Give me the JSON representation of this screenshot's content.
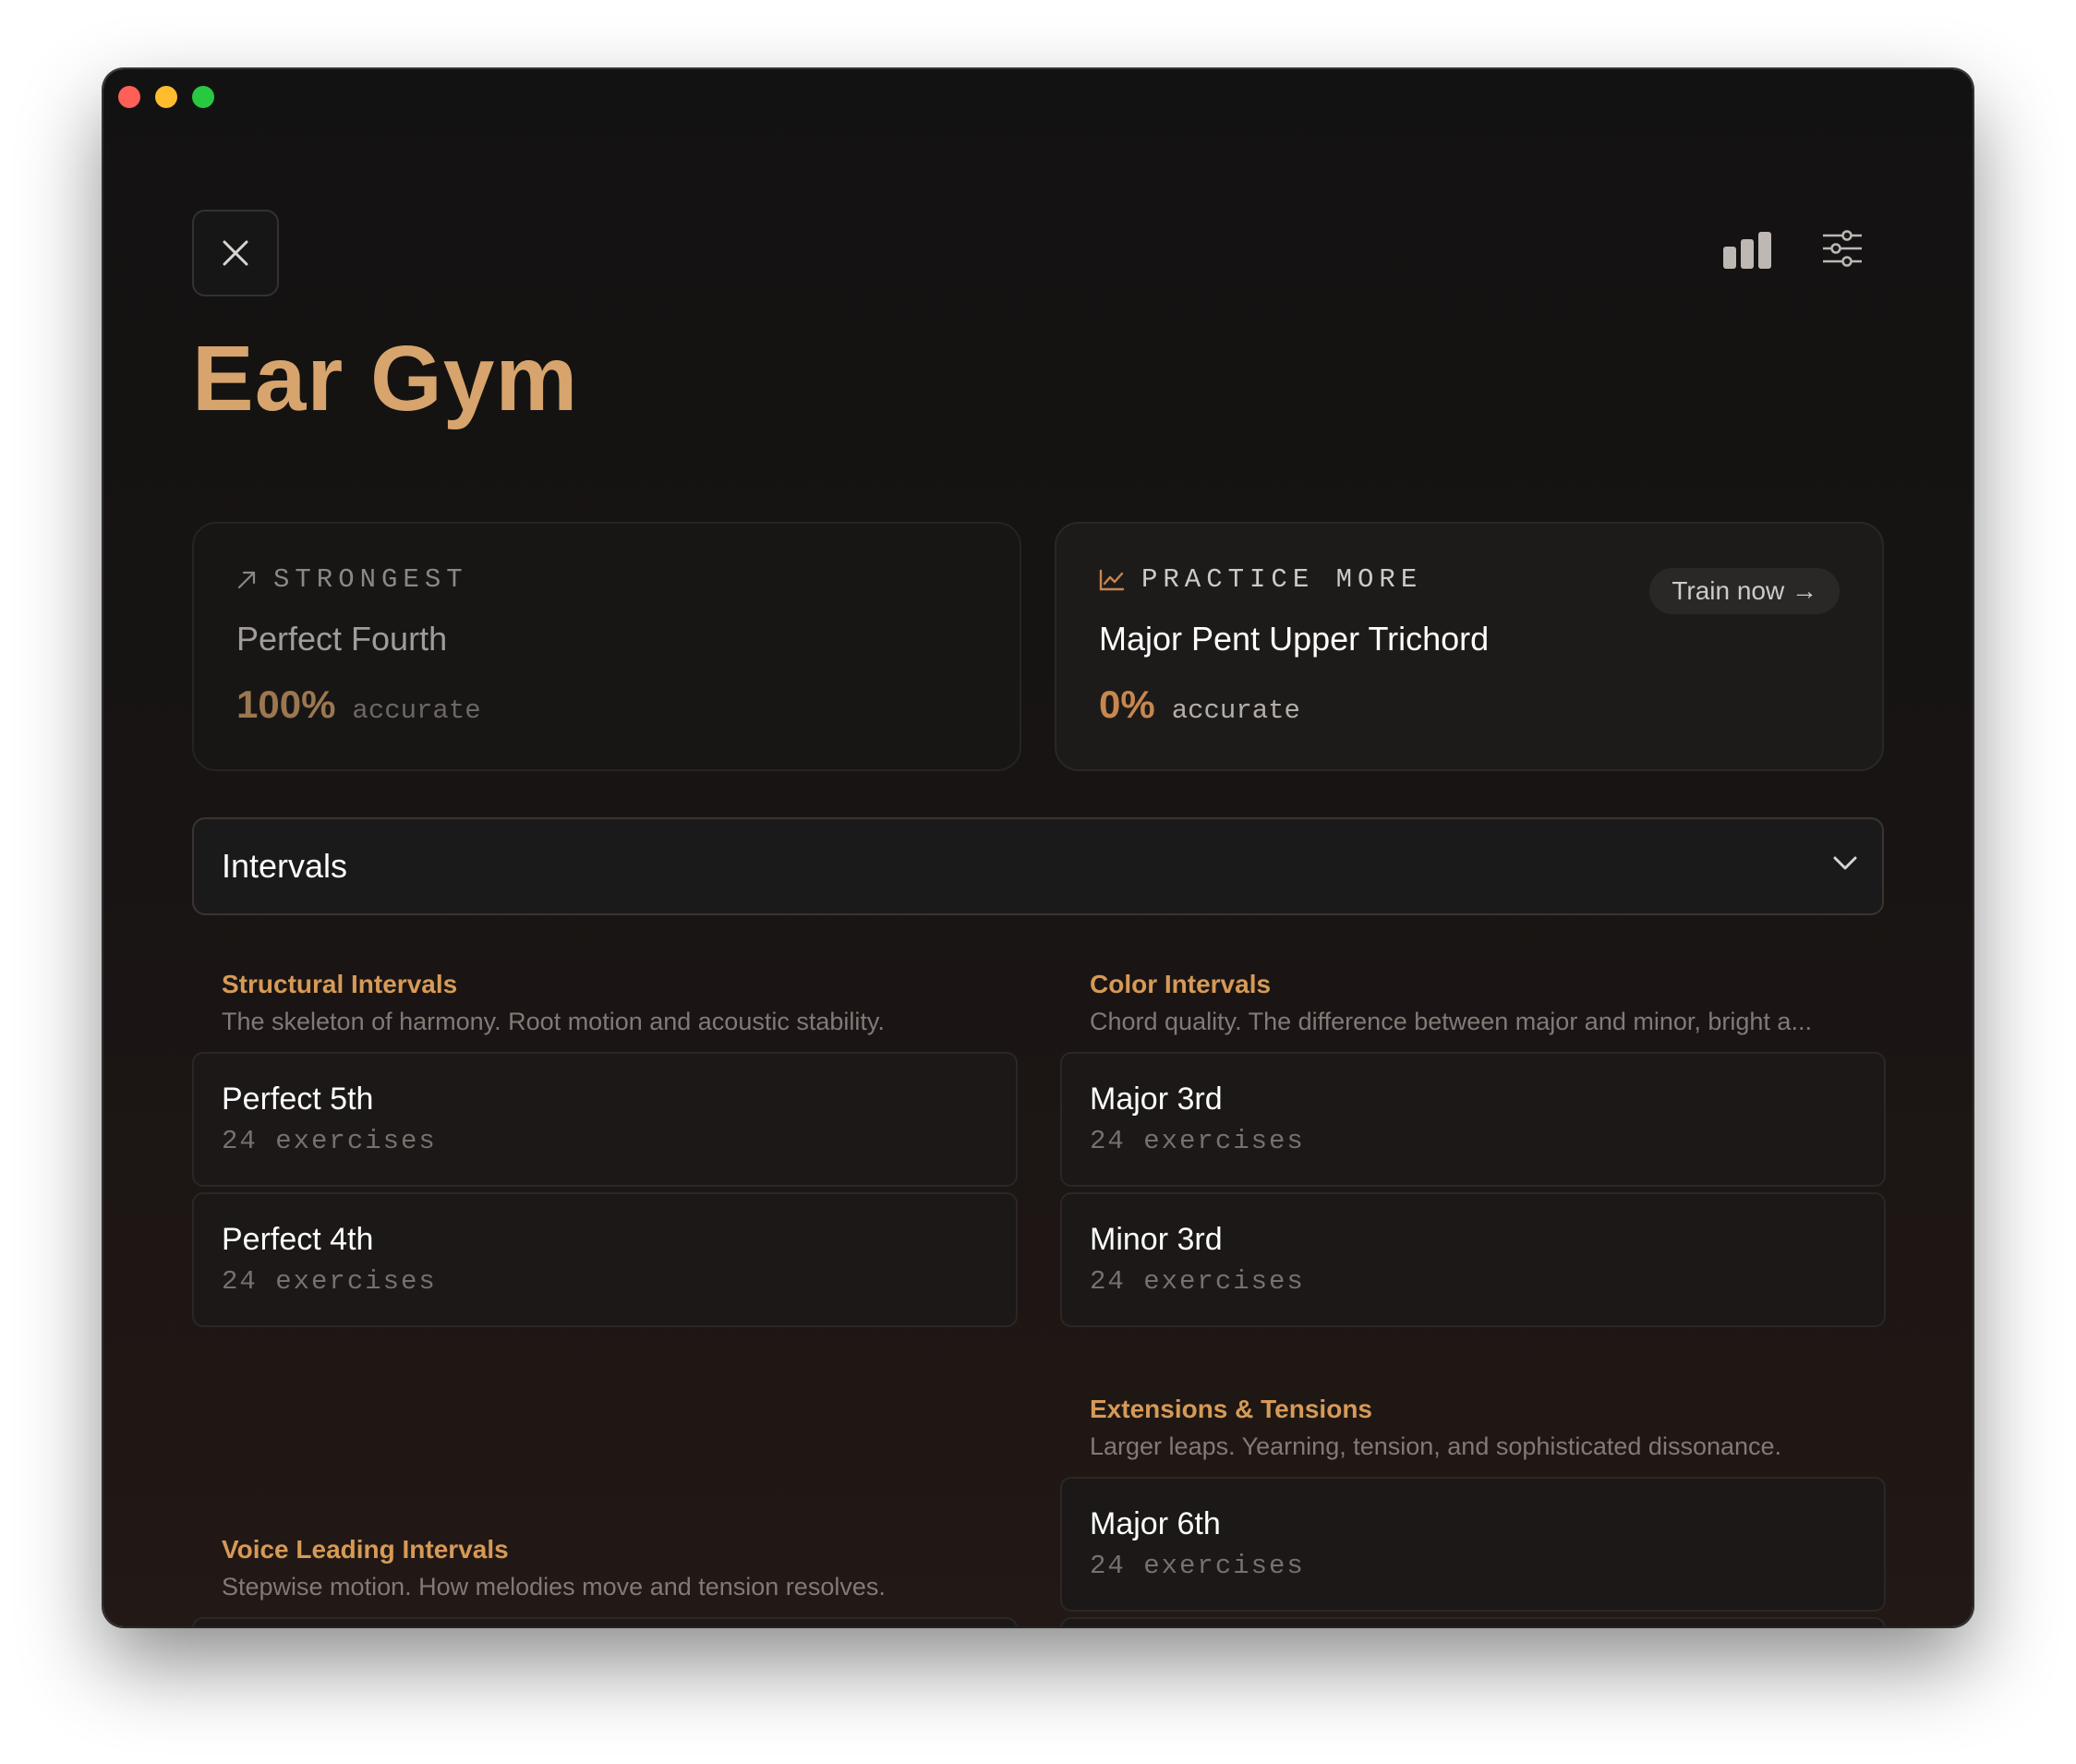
{
  "header": {
    "title": "Ear Gym",
    "close_icon": "close-icon",
    "stats_icon": "bar-chart-icon",
    "settings_icon": "sliders-icon"
  },
  "highlights": {
    "strongest": {
      "label": "STRONGEST",
      "icon": "arrow-up-right-icon",
      "name": "Perfect Fourth",
      "percent": "100%",
      "accuracy_label": "accurate"
    },
    "practice_more": {
      "label": "PRACTICE MORE",
      "icon": "trend-chart-icon",
      "name": "Major Pent Upper Trichord",
      "percent": "0%",
      "accuracy_label": "accurate",
      "action_label": "Train now →"
    }
  },
  "category_select": {
    "selected": "Intervals"
  },
  "groups": {
    "structural": {
      "title": "Structural Intervals",
      "description": "The skeleton of harmony. Root motion and acoustic stability.",
      "items": [
        {
          "name": "Perfect 5th",
          "count": "24 exercises"
        },
        {
          "name": "Perfect 4th",
          "count": "24 exercises"
        }
      ]
    },
    "color": {
      "title": "Color Intervals",
      "description": "Chord quality. The difference between major and minor, bright a...",
      "items": [
        {
          "name": "Major 3rd",
          "count": "24 exercises"
        },
        {
          "name": "Minor 3rd",
          "count": "24 exercises"
        }
      ]
    },
    "extensions": {
      "title": "Extensions & Tensions",
      "description": "Larger leaps. Yearning, tension, and sophisticated dissonance.",
      "items": [
        {
          "name": "Major 6th",
          "count": "24 exercises"
        }
      ]
    },
    "voice_leading": {
      "title": "Voice Leading Intervals",
      "description": "Stepwise motion. How melodies move and tension resolves."
    }
  },
  "colors": {
    "accent": "#d6a46c",
    "group_title": "#d69a56",
    "background": "#151312"
  }
}
